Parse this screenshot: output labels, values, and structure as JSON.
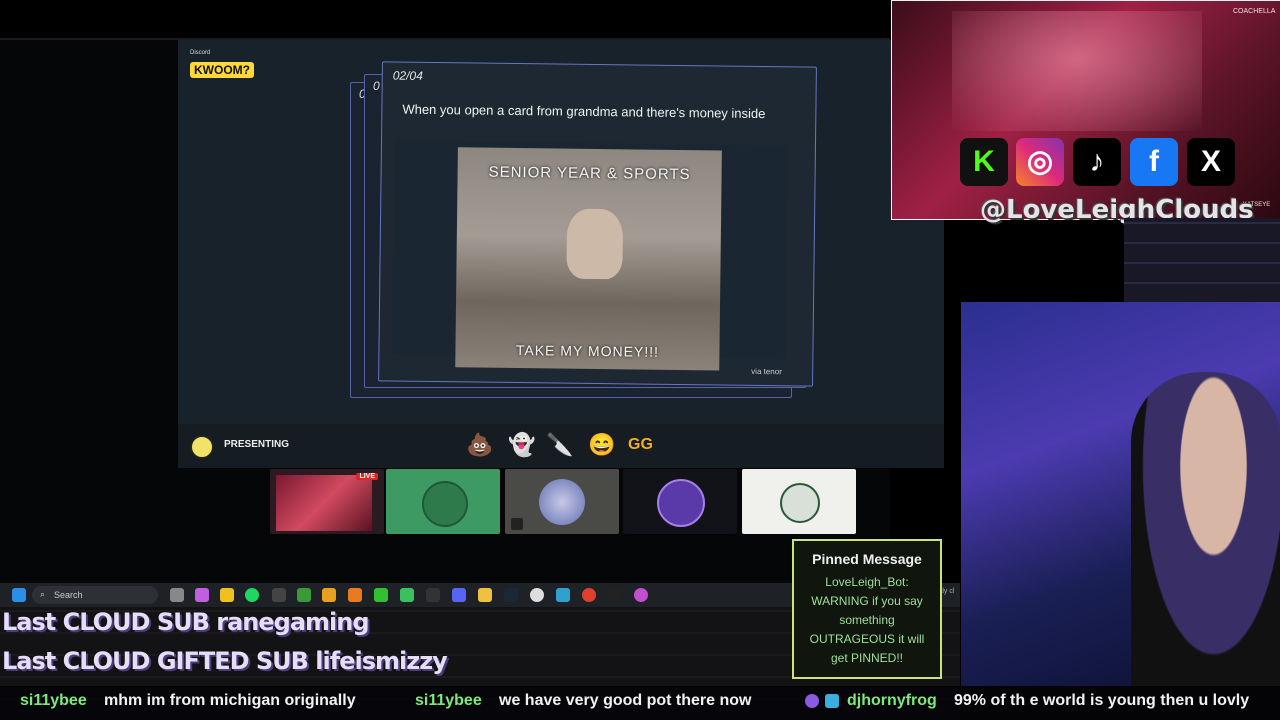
{
  "discord": {
    "app_tag": "Discord",
    "game_logo": "KWOOM?",
    "card": {
      "counter": "02/04",
      "back_counter_1": "0",
      "back_counter_2": "0",
      "caption": "When you open a card from grandma and there's money inside",
      "gif_top_text": "SENIOR YEAR & SPORTS",
      "gif_bottom_text": "TAKE MY MONEY!!!",
      "gif_source": "via tenor"
    },
    "presenting_label": "PRESENTING",
    "reactions": [
      "💩",
      "👻",
      "🔪",
      "😄",
      "GG"
    ],
    "live_badge": "LIVE"
  },
  "taskbar": {
    "search_placeholder": "Search",
    "icons": [
      "windows-start-icon",
      "search-icon",
      "task-view-icon",
      "copilot-icon",
      "sticky-notes-icon",
      "spotify-icon",
      "xbox-icon",
      "minecraft-icon",
      "app-icon",
      "autodesk-icon",
      "media-icon",
      "game-icon",
      "epic-icon",
      "discord-icon",
      "file-explorer-icon",
      "steam-icon",
      "chrome-icon",
      "app2-icon",
      "chrome-icon",
      "obs-icon",
      "chrome-icon"
    ]
  },
  "overlay": {
    "last_sub": "Last CLOUD SUB ranegaming",
    "last_gifted_sub": "Last CLOUD GIFTED SUB lifeismizzy",
    "handle": "@LoveLeighClouds",
    "preview_tag": "COACHELLA",
    "preview_tag2": "KATSEYE",
    "taskbar_right_text": "ostly cl"
  },
  "pinned_message": {
    "title": "Pinned Message",
    "body": "LoveLeigh_Bot: WARNING if you say something OUTRAGEOUS it will get PINNED!!"
  },
  "chat": [
    {
      "user": "si11ybee",
      "message": "mhm im from michigan originally"
    },
    {
      "user": "si11ybee",
      "message": "we have very good pot there now"
    },
    {
      "user": "djhornyfrog",
      "message": "99% of th e world is young then u lovly"
    }
  ],
  "socials": [
    "kick-icon",
    "instagram-icon",
    "tiktok-icon",
    "facebook-icon",
    "x-icon"
  ]
}
